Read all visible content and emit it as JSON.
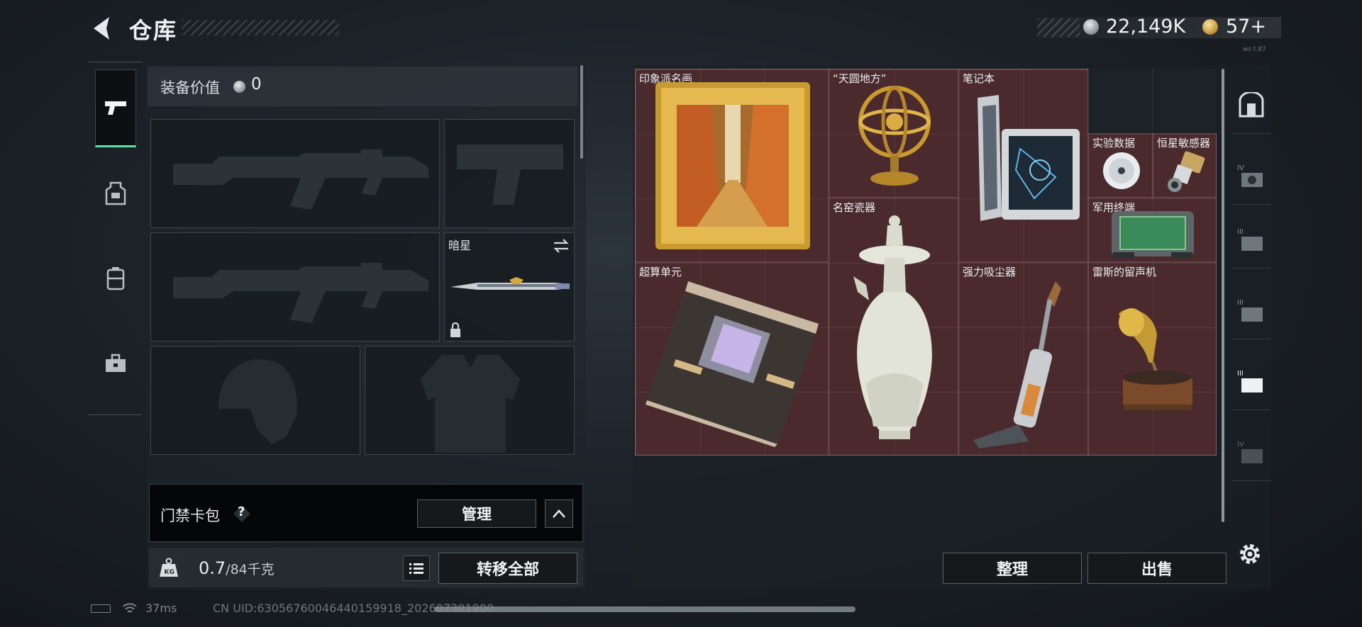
{
  "header": {
    "title": "仓库",
    "money": "22,149K",
    "tokens": "57+",
    "tiny_text": "ws t.87"
  },
  "equipment": {
    "value_label": "装备价值",
    "value": "0",
    "melee_name": "暗星"
  },
  "keycard": {
    "label": "门禁卡包",
    "help": "?",
    "manage_label": "管理"
  },
  "capacity": {
    "current": "0.7",
    "max": "/84千克",
    "transfer_label": "转移全部"
  },
  "status": {
    "ping": "37ms",
    "uid": "CN UID:63056760046440159918_202607301900"
  },
  "storage": {
    "items": [
      {
        "name": "印象派名画",
        "icon": "painting-icon"
      },
      {
        "name": "“天圆地方”",
        "icon": "armillary-sphere-icon"
      },
      {
        "name": "笔记本",
        "icon": "laptop-icon"
      },
      {
        "name": "实验数据",
        "icon": "disc-icon"
      },
      {
        "name": "恒星敏感器",
        "icon": "star-sensor-icon"
      },
      {
        "name": "名窑瓷器",
        "icon": "porcelain-vase-icon"
      },
      {
        "name": "军用终端",
        "icon": "military-terminal-icon"
      },
      {
        "name": "超算单元",
        "icon": "supercomputer-unit-icon"
      },
      {
        "name": "强力吸尘器",
        "icon": "vacuum-cleaner-icon"
      },
      {
        "name": "雷斯的留声机",
        "icon": "gramophone-icon"
      }
    ],
    "sort_label": "整理",
    "sell_label": "出售"
  },
  "filters": [
    "safebox-icon",
    "tier-iv-icon",
    "tier-iii-icon",
    "tier-iii-icon",
    "tier-iii-selected-icon",
    "tier-iv-icon"
  ],
  "colors": {
    "accent": "#5ee3a8",
    "grid_bg": "#4a2a2d"
  }
}
